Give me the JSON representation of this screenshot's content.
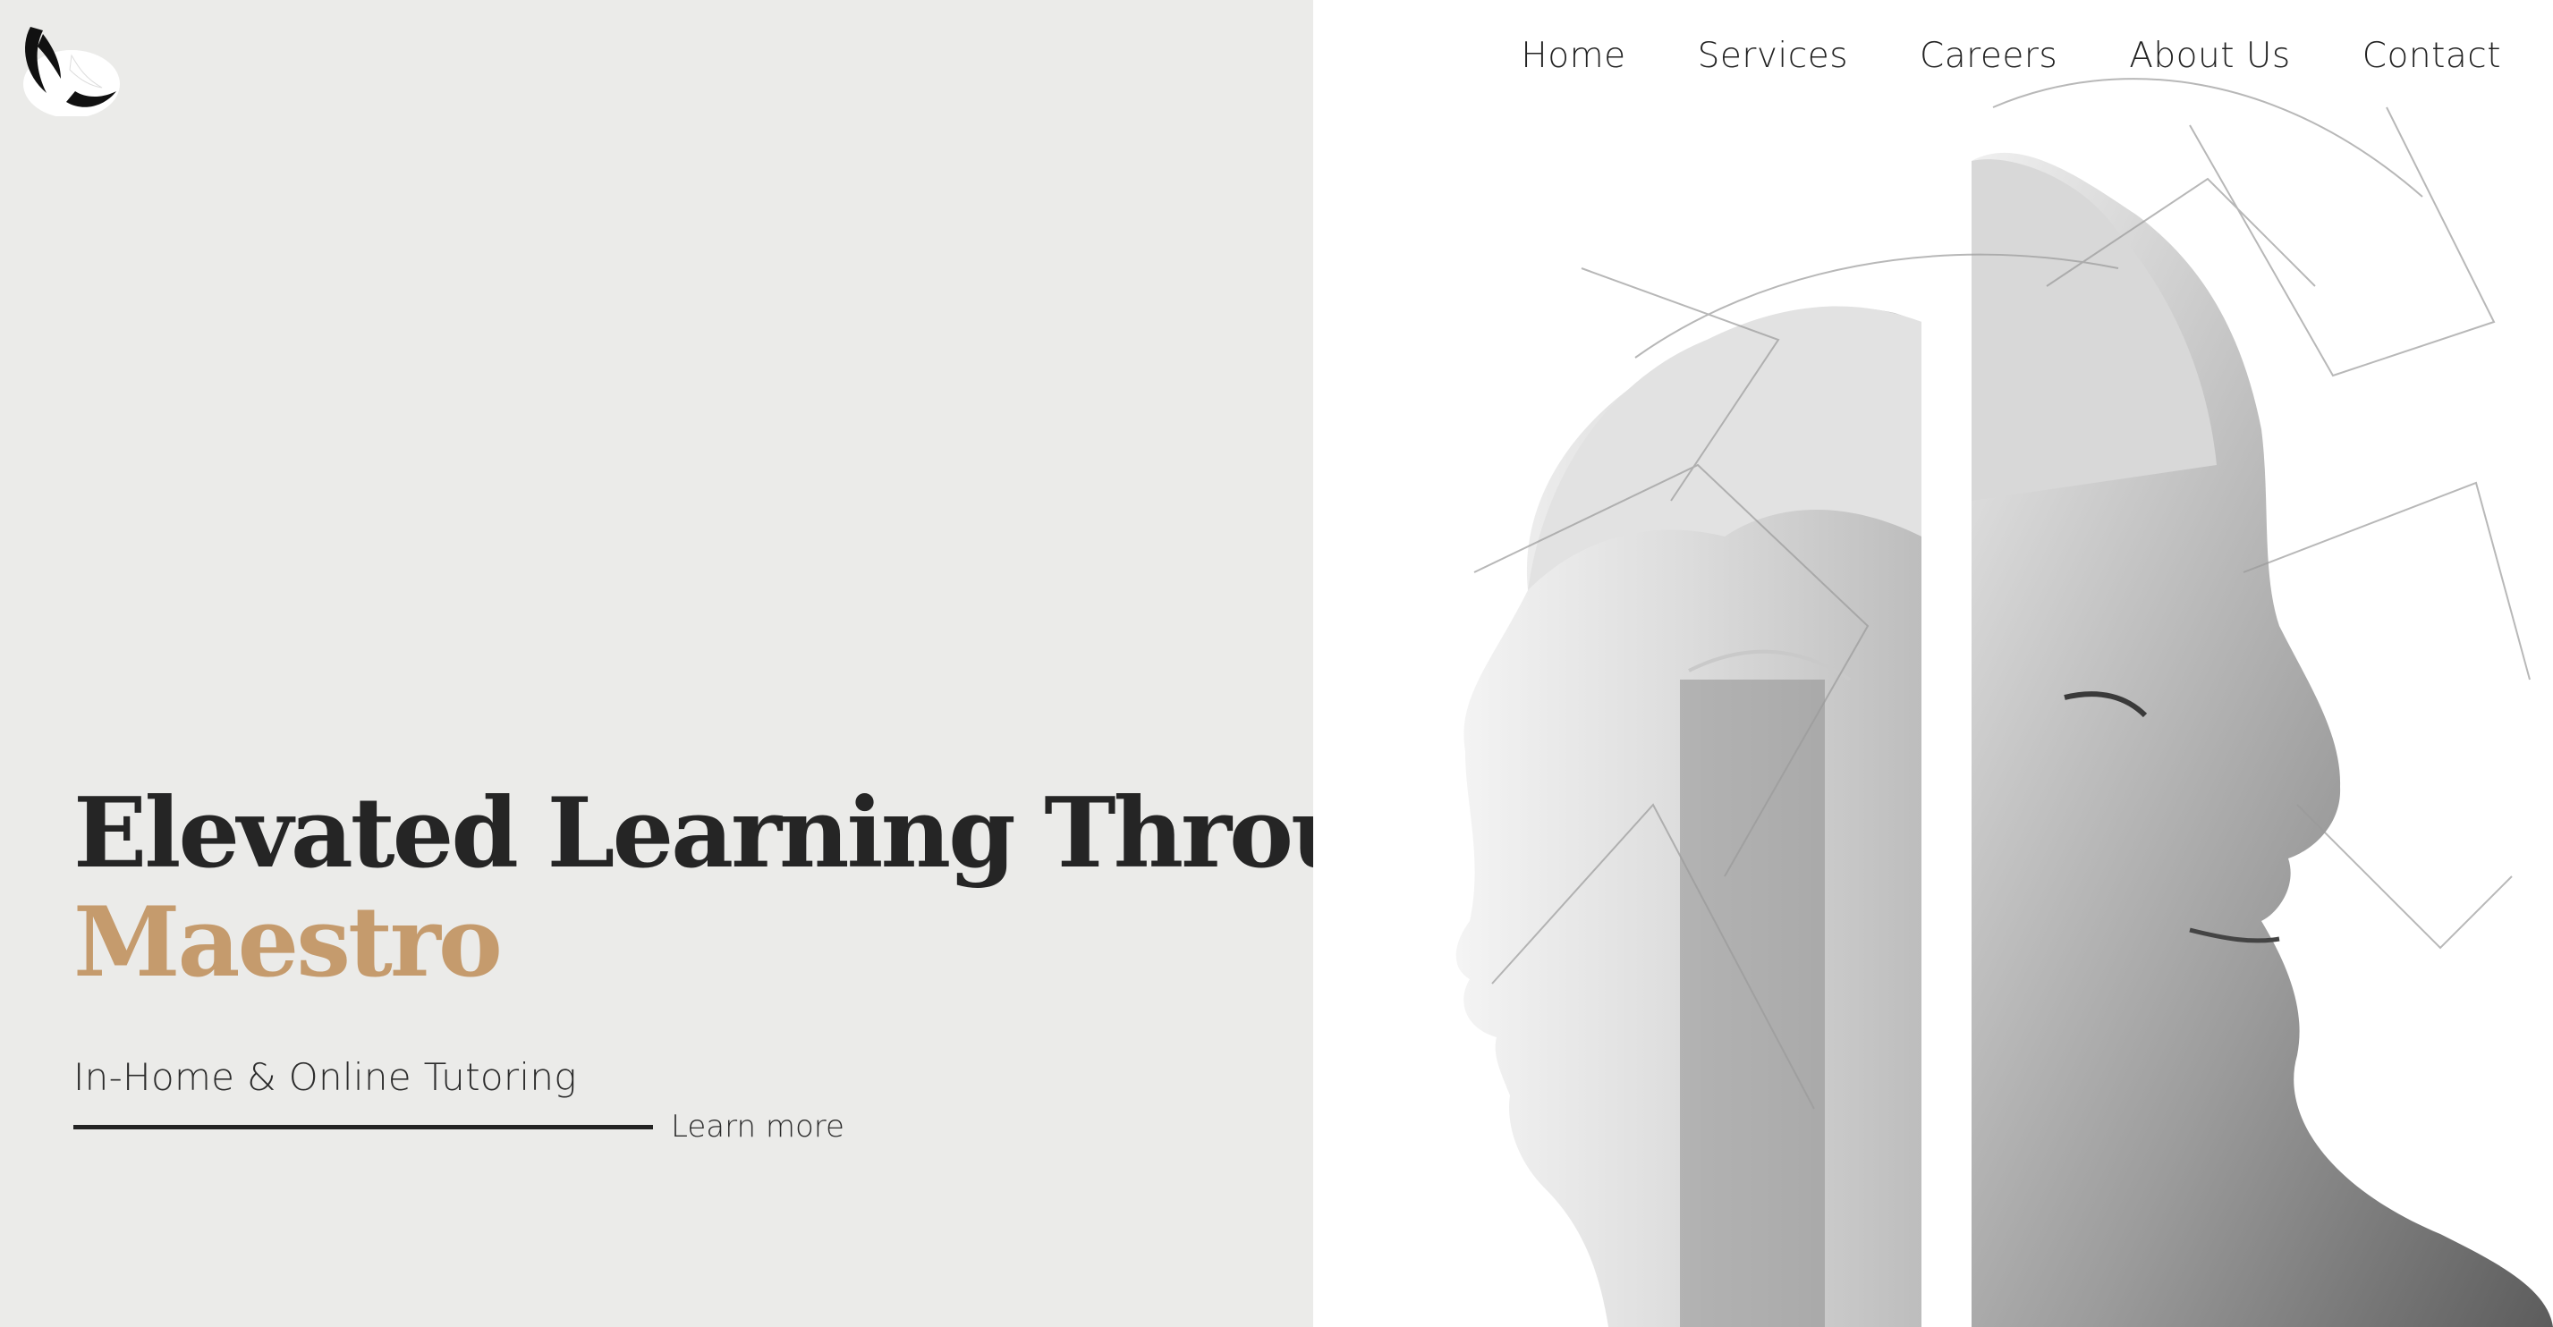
{
  "nav": {
    "items": [
      {
        "label": "Home"
      },
      {
        "label": "Services"
      },
      {
        "label": "Careers"
      },
      {
        "label": "About Us"
      },
      {
        "label": "Contact"
      }
    ]
  },
  "hero": {
    "title_line1": "Elevated Learning Through",
    "title_accent": "Maestro",
    "subtitle": "In-Home & Online Tutoring",
    "cta_label": "Learn more"
  },
  "icons": {
    "logo": "brand-logo-icon"
  },
  "colors": {
    "left_background": "#ebebe9",
    "accent": "#c59b6d",
    "text": "#252525",
    "right_background": "#ffffff"
  }
}
